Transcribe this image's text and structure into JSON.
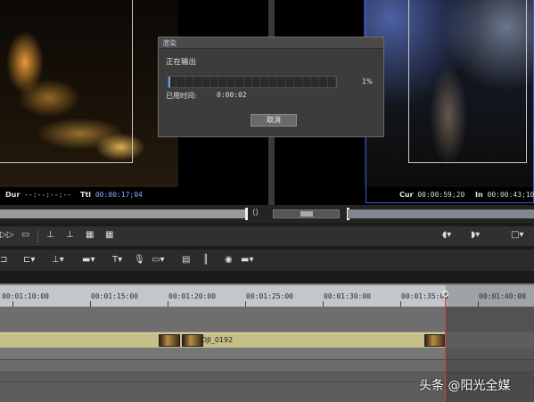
{
  "player_left": {
    "dur_label": "Dur",
    "dur_value": "--:--:--:--",
    "ttl_label": "Ttl",
    "ttl_value": "00:00:17;04"
  },
  "player_right": {
    "cur_label": "Cur",
    "cur_value": "00:00:59;20",
    "in_label": "In",
    "in_value": "00:00:43;10"
  },
  "render_dialog": {
    "title": "渲染",
    "status": "正在输出",
    "progress_percent": 1,
    "progress_text": "1%",
    "elapsed_label": "已用时间:",
    "elapsed_value": "0:00:02",
    "cancel_label": "取消"
  },
  "timeline": {
    "ruler_labels": [
      "00:01:10:00",
      "00:01:15:00",
      "00:01:20:00",
      "00:01:25:00",
      "00:01:30:00",
      "00:01:35:00",
      "00:01:40:00"
    ],
    "clip_name": "DJI_0192"
  },
  "watermark": "头条 @阳光全媒",
  "colors": {
    "clip": "#c7bf88",
    "playhead": "#e43b3b",
    "progress_fill": "#6aa0e8",
    "timecode": "#7fb0ff"
  }
}
